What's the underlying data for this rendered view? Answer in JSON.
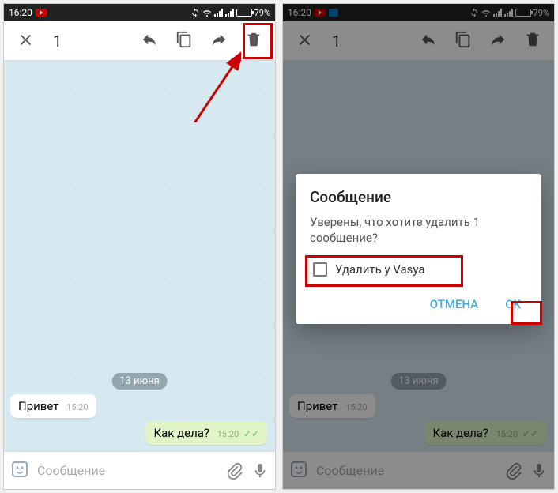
{
  "status": {
    "time": "16:20",
    "battery_pct": "79%"
  },
  "toolbar": {
    "selected_count": "1"
  },
  "chat": {
    "date_label": "13 июня",
    "incoming": {
      "text": "Привет",
      "time": "15:20"
    },
    "outgoing": {
      "text": "Как дела?",
      "time": "15:20"
    }
  },
  "input": {
    "placeholder": "Сообщение"
  },
  "dialog": {
    "title": "Сообщение",
    "body": "Уверены, что хотите удалить 1 сообщение?",
    "checkbox_label": "Удалить у Vasya",
    "cancel": "ОТМЕНА",
    "ok": "OK"
  }
}
